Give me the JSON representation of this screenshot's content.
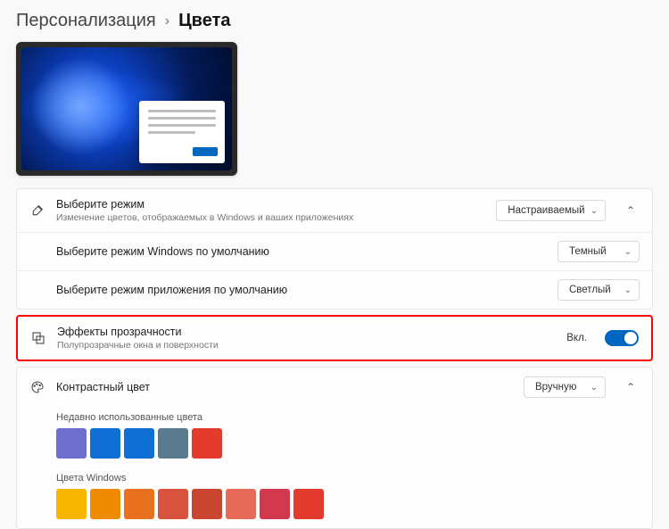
{
  "breadcrumb": {
    "parent": "Персонализация",
    "sep": "›",
    "current": "Цвета"
  },
  "mode": {
    "title": "Выберите режим",
    "desc": "Изменение цветов, отображаемых в Windows и ваших приложениях",
    "value": "Настраиваемый",
    "sub_windows_label": "Выберите режим Windows по умолчанию",
    "sub_windows_value": "Темный",
    "sub_app_label": "Выберите режим приложения по умолчанию",
    "sub_app_value": "Светлый"
  },
  "transparency": {
    "title": "Эффекты прозрачности",
    "desc": "Полупрозрачные окна и поверхности",
    "state_label": "Вкл.",
    "on": true
  },
  "contrast": {
    "title": "Контрастный цвет",
    "value": "Вручную"
  },
  "recent_label": "Недавно использованные цвета",
  "recent_colors": [
    "#6f6fcf",
    "#0f6fd4",
    "#0f6fd4",
    "#5a7a8d",
    "#e23a2c"
  ],
  "windows_label": "Цвета Windows",
  "windows_colors": [
    "#f7b500",
    "#f08a00",
    "#e8701f",
    "#d7533e",
    "#c94530",
    "#e86b5a",
    "#d2394f",
    "#e23a2c"
  ]
}
